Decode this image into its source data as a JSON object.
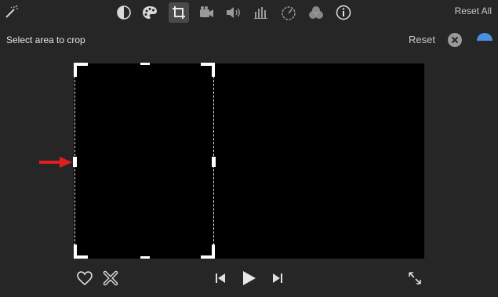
{
  "toolbar": {
    "icons": [
      "magic-wand-icon",
      "color-balance-icon",
      "color-palette-icon",
      "crop-icon",
      "stabilization-camera-icon",
      "volume-icon",
      "equalizer-icon",
      "speed-icon",
      "filter-icon",
      "info-icon"
    ],
    "reset_all_label": "Reset All"
  },
  "crop_panel": {
    "instruction": "Select area to crop",
    "reset_label": "Reset"
  },
  "colors": {
    "background": "#262626",
    "preview": "#000000",
    "apply_blue": "#4a8fe0",
    "arrow_red": "#e02020"
  },
  "playback": {
    "icons": [
      "favorite-heart-icon",
      "reject-x-icon",
      "skip-back-icon",
      "play-icon",
      "skip-forward-icon",
      "fullscreen-icon"
    ]
  }
}
